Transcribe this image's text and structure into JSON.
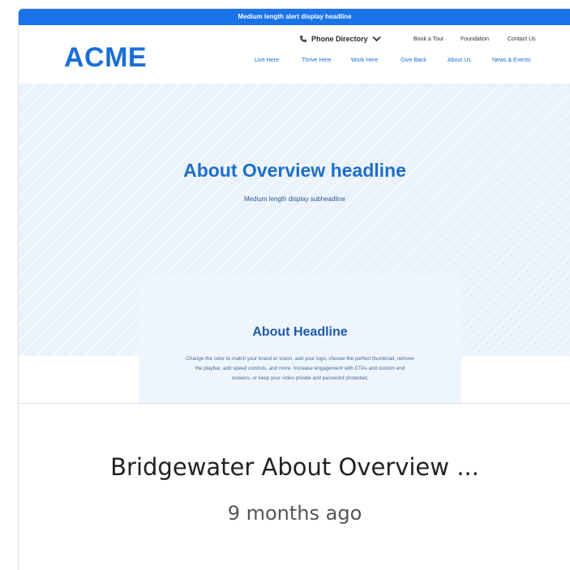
{
  "card": {
    "title": "Bridgewater About Overview ...",
    "time_ago": "9 months ago"
  },
  "thumbnail": {
    "alert_text": "Medium length alert display headline",
    "logo": "ACME",
    "phone_directory": "Phone Directory",
    "utility_links": [
      "Book a Tour",
      "Foundation",
      "Contact Us"
    ],
    "nav_links": [
      "Live Here",
      "Thrive Here",
      "Work Here",
      "Give Back",
      "About Us",
      "News & Events"
    ],
    "hero_headline": "About Overview headline",
    "hero_subheadline": "Medium length display subheadline",
    "about_headline": "About Headline",
    "about_body": "Change the color to match your brand or vision, add your logo, choose the perfect thumbnail, remove the playbar, add speed controls, and more. Increase engagement with CTAs and custom end screens, or keep your video private and password protected."
  },
  "colors": {
    "accent": "#1a73e8",
    "logo": "#1a6fd6",
    "hero_background": "#eaf2fc"
  },
  "icons": {
    "phone": "phone-icon",
    "dropdown": "chevron-down-icon"
  }
}
